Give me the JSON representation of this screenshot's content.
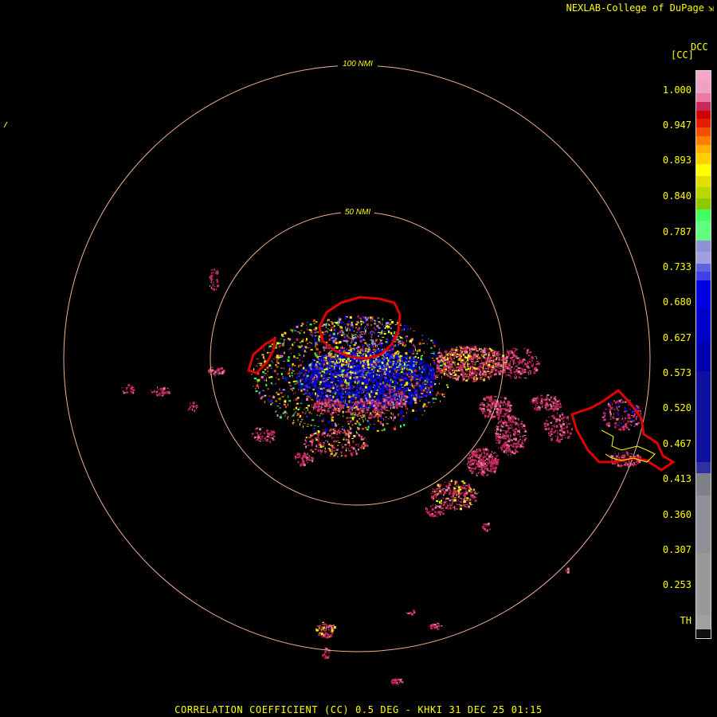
{
  "credit": "NEXLAB-College of DuPage",
  "credit_icon": "link-icon",
  "product_code": "DCC",
  "unit_label": "[CC]",
  "footer": "CORRELATION COEFFICIENT (CC) 0.5 DEG - KHKI 31 DEC 25 01:15",
  "range_rings": [
    {
      "label": "100 NMI"
    },
    {
      "label": "50 NMI"
    }
  ],
  "legend": {
    "ticks": [
      "1.000",
      "0.947",
      "0.893",
      "0.840",
      "0.787",
      "0.733",
      "0.680",
      "0.627",
      "0.573",
      "0.520",
      "0.467",
      "0.413",
      "0.360",
      "0.307",
      "0.253",
      "TH"
    ],
    "colors": [
      "#f6a6c8",
      "#f0a0c0",
      "#e87aa4",
      "#c8285a",
      "#d00000",
      "#e02000",
      "#f05000",
      "#ff8000",
      "#ffb000",
      "#ffd000",
      "#ffff00",
      "#e0e000",
      "#b8d800",
      "#90c800",
      "#40ff60",
      "#60ff80",
      "#9090d8",
      "#a0a0e0",
      "#6060e0",
      "#4040e8",
      "#0000e0",
      "#0000c8",
      "#0000b0",
      "#1010a0",
      "#3030a0",
      "#808088",
      "#909098",
      "#989898",
      "#a0a0a0",
      "#101010"
    ],
    "stops": [
      0.0,
      0.02,
      0.04,
      0.055,
      0.07,
      0.085,
      0.1,
      0.115,
      0.13,
      0.145,
      0.165,
      0.185,
      0.205,
      0.225,
      0.245,
      0.265,
      0.3,
      0.32,
      0.34,
      0.355,
      0.37,
      0.42,
      0.48,
      0.53,
      0.69,
      0.71,
      0.75,
      0.85,
      0.96,
      0.985
    ]
  },
  "colors": {
    "ring": "#f0b090",
    "warning_outline": "#e00000",
    "county_line": "#ffff00",
    "text": "#ffff00"
  }
}
